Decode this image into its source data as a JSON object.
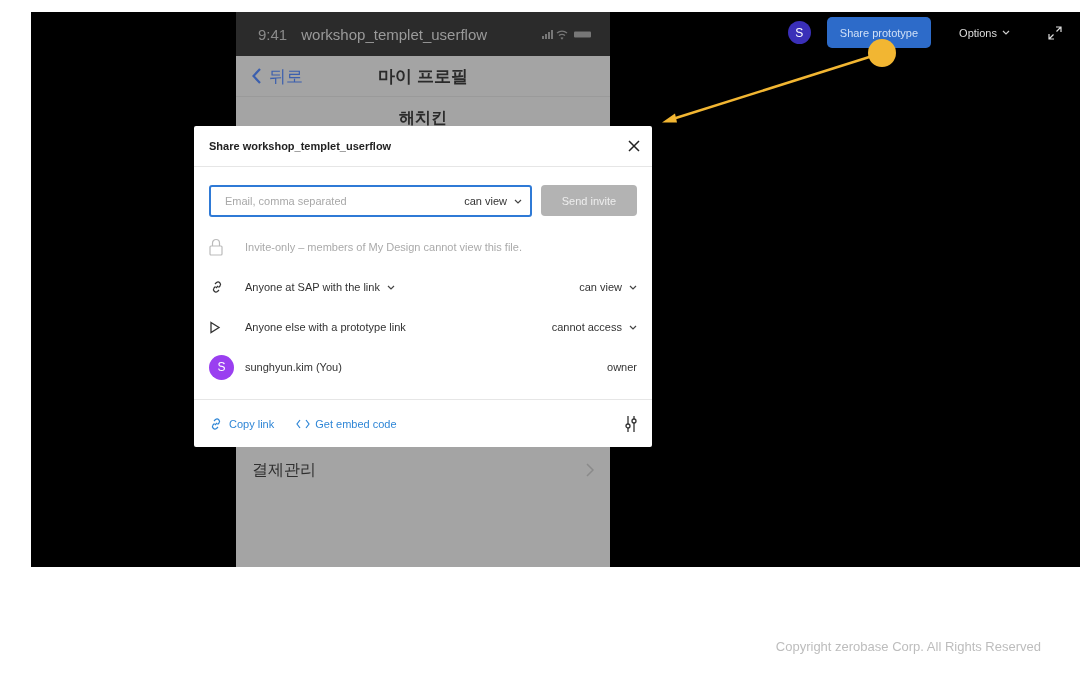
{
  "phone": {
    "status_time": "9:41",
    "status_title": "workshop_templet_userflow",
    "back_label": "뒤로",
    "nav_title": "마이 프로필",
    "profile_name": "해치킨",
    "menu_items": [
      {
        "label": "결제관리"
      }
    ]
  },
  "toolbar": {
    "avatar_letter": "S",
    "share_button": "Share prototype",
    "options": "Options"
  },
  "dialog": {
    "title": "Share workshop_templet_userflow",
    "email_placeholder": "Email, comma separated",
    "invite_permission": "can view",
    "send_button": "Send invite",
    "send_disabled": true,
    "notice": "Invite-only – members of My Design cannot view this file.",
    "rows": [
      {
        "kind": "link",
        "label": "Anyone at SAP with the link",
        "label_dropdown": true,
        "permission": "can view",
        "permission_dropdown": true
      },
      {
        "kind": "prototype",
        "label": "Anyone else with a prototype link",
        "label_dropdown": false,
        "permission": "cannot access",
        "permission_dropdown": true
      },
      {
        "kind": "user",
        "avatar_letter": "S",
        "label": "sunghyun.kim (You)",
        "label_dropdown": false,
        "permission": "owner",
        "permission_dropdown": false
      }
    ],
    "copy_link": "Copy link",
    "embed_code": "Get embed code"
  },
  "copyright": "Copyright zerobase Corp. All Rights Reserved"
}
